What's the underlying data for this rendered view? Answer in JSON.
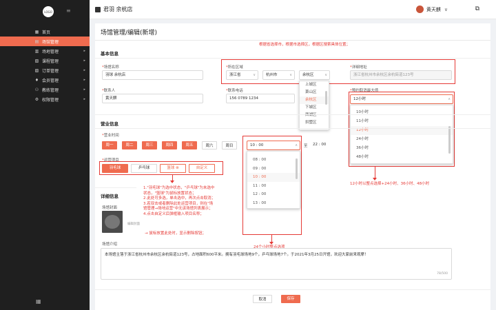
{
  "sidebar": {
    "logo": "LOGO",
    "items": [
      {
        "icon": "▦",
        "label": "首页",
        "active": false,
        "arrow": ""
      },
      {
        "icon": "▤",
        "label": "场馆管理",
        "active": true,
        "arrow": ""
      },
      {
        "icon": "▥",
        "label": "场地管理",
        "active": false,
        "arrow": "▸"
      },
      {
        "icon": "▧",
        "label": "课程管理",
        "active": false,
        "arrow": "▸"
      },
      {
        "icon": "▨",
        "label": "订单管理",
        "active": false,
        "arrow": "▸"
      },
      {
        "icon": "♦",
        "label": "会员管理",
        "active": false,
        "arrow": "▸"
      },
      {
        "icon": "⚇",
        "label": "教练管理",
        "active": false,
        "arrow": "▸"
      },
      {
        "icon": "⚙",
        "label": "权限管理",
        "active": false,
        "arrow": "▸"
      }
    ]
  },
  "header": {
    "brand": "君羽 余杭店",
    "user": "黄天麒",
    "user_chev": "∨",
    "right_icon": "⧉"
  },
  "page_title": "场馆管理/编辑(新增)",
  "basic": {
    "section": "基本信息",
    "venue_name_label": "场馆名称",
    "venue_name": "羽球 余杭店",
    "contact_label": "联系人",
    "contact": "黄天麒",
    "region_label": "所在区域",
    "province": "浙江省",
    "city": "杭州市",
    "district": "余杭区",
    "address_label": "详细地址",
    "address": "浙江省杭州市余杭区余杭街道123号",
    "phone_label": "联系电话",
    "phone": "156 0789 1234",
    "advance_label": "预约取消最大值",
    "advance": "12小时",
    "district_options": [
      "上城区",
      "萧山区",
      "余杭区",
      "下城区",
      "西湖区",
      "拱墅区"
    ],
    "advance_options": [
      "10小时",
      "11小时",
      "12小时",
      "24小时",
      "36小时",
      "48小时"
    ],
    "ann_region": "根据省选择市，根据市选择区，根据区搜索具体位置；",
    "ann_advance": "12小时以整点选择+24小时、36小时、48小时"
  },
  "business": {
    "section": "营业信息",
    "hours_label": "营业时间",
    "days": [
      {
        "label": "周一",
        "on": true
      },
      {
        "label": "周二",
        "on": true
      },
      {
        "label": "周三",
        "on": true
      },
      {
        "label": "周四",
        "on": true
      },
      {
        "label": "周五",
        "on": true
      },
      {
        "label": "周六",
        "on": false
      },
      {
        "label": "周日",
        "on": false
      }
    ],
    "start_time": "10 : 00",
    "end_time": "22 : 00",
    "to": "至",
    "time_options": [
      "08 : 00",
      "09 : 00",
      "10 : 00",
      "11 : 00",
      "12 : 00",
      "13 : 00"
    ],
    "projects_label": "运营项目",
    "projects": [
      "羽毛球",
      "乒乓球",
      "篮球",
      "自定义"
    ],
    "project_close": "⊗",
    "ann_projects": "1.\"羽毛球\"为选中状态，\"乒乓球\"为未选中\n状态，\"篮球\"为鼠标放置状态；\n2.此处可多选，单击选中，再次点击取消；\n3.若双击或者删除此处运营项目，则在\"场\n馆管理→场地运营\"中无该场馆列表展示；\n4.点击自定义后弹框输入项目名称；",
    "ann_time": "24个小时整点选项"
  },
  "detail": {
    "section": "详细信息",
    "pic_label": "场馆封面",
    "pic_note": "编辑封面",
    "ann_pic": "鼠标放置此处时，显示删除按钮；",
    "intro_label": "场馆介绍",
    "intro": "本场馆主落于浙江省杭州市余杭区余杭街道123号，占地面积600平米。拥有羽毛球场地9个，乒乓球场地7个。于2021年3月25日开馆，欢迎大家前来观摩！",
    "counter": "78/500"
  },
  "footer": {
    "cancel": "取消",
    "save": "保存"
  },
  "colors": {
    "accent": "#ef6b4f",
    "annotation": "#e53935",
    "sidebar": "#1f1f1f"
  }
}
